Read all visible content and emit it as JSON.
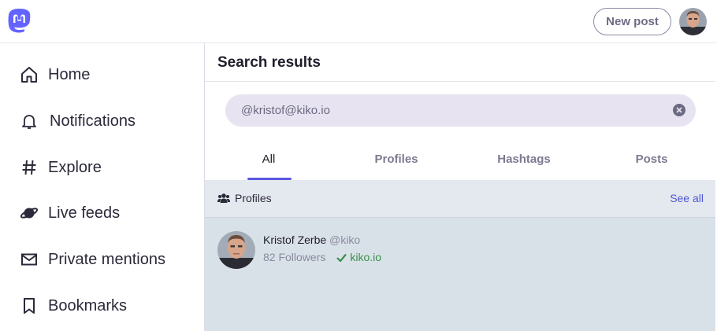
{
  "topbar": {
    "logo_icon": "mastodon-logo-icon",
    "new_post_label": "New post",
    "avatar_icon": "user-avatar"
  },
  "sidebar": {
    "items": [
      {
        "label": "Home",
        "icon": "home-icon"
      },
      {
        "label": "Notifications",
        "icon": "bell-icon"
      },
      {
        "label": "Explore",
        "icon": "hashtag-icon"
      },
      {
        "label": "Live feeds",
        "icon": "planet-icon"
      },
      {
        "label": "Private mentions",
        "icon": "envelope-icon"
      },
      {
        "label": "Bookmarks",
        "icon": "bookmark-icon"
      }
    ]
  },
  "main": {
    "title": "Search results",
    "search": {
      "value": "@kristof@kiko.io",
      "placeholder": ""
    },
    "tabs": [
      {
        "label": "All",
        "active": true
      },
      {
        "label": "Profiles",
        "active": false
      },
      {
        "label": "Hashtags",
        "active": false
      },
      {
        "label": "Posts",
        "active": false
      }
    ],
    "section": {
      "title": "Profiles",
      "see_all": "See all"
    },
    "results": [
      {
        "name": "Kristof Zerbe",
        "handle": "@kiko",
        "followers": "82 Followers",
        "verified_domain": "kiko.io"
      }
    ]
  },
  "colors": {
    "accent": "#5b55e0",
    "brand": "#6364ff",
    "verified": "#3a8f4a",
    "result_bg": "#d9e1e8"
  }
}
